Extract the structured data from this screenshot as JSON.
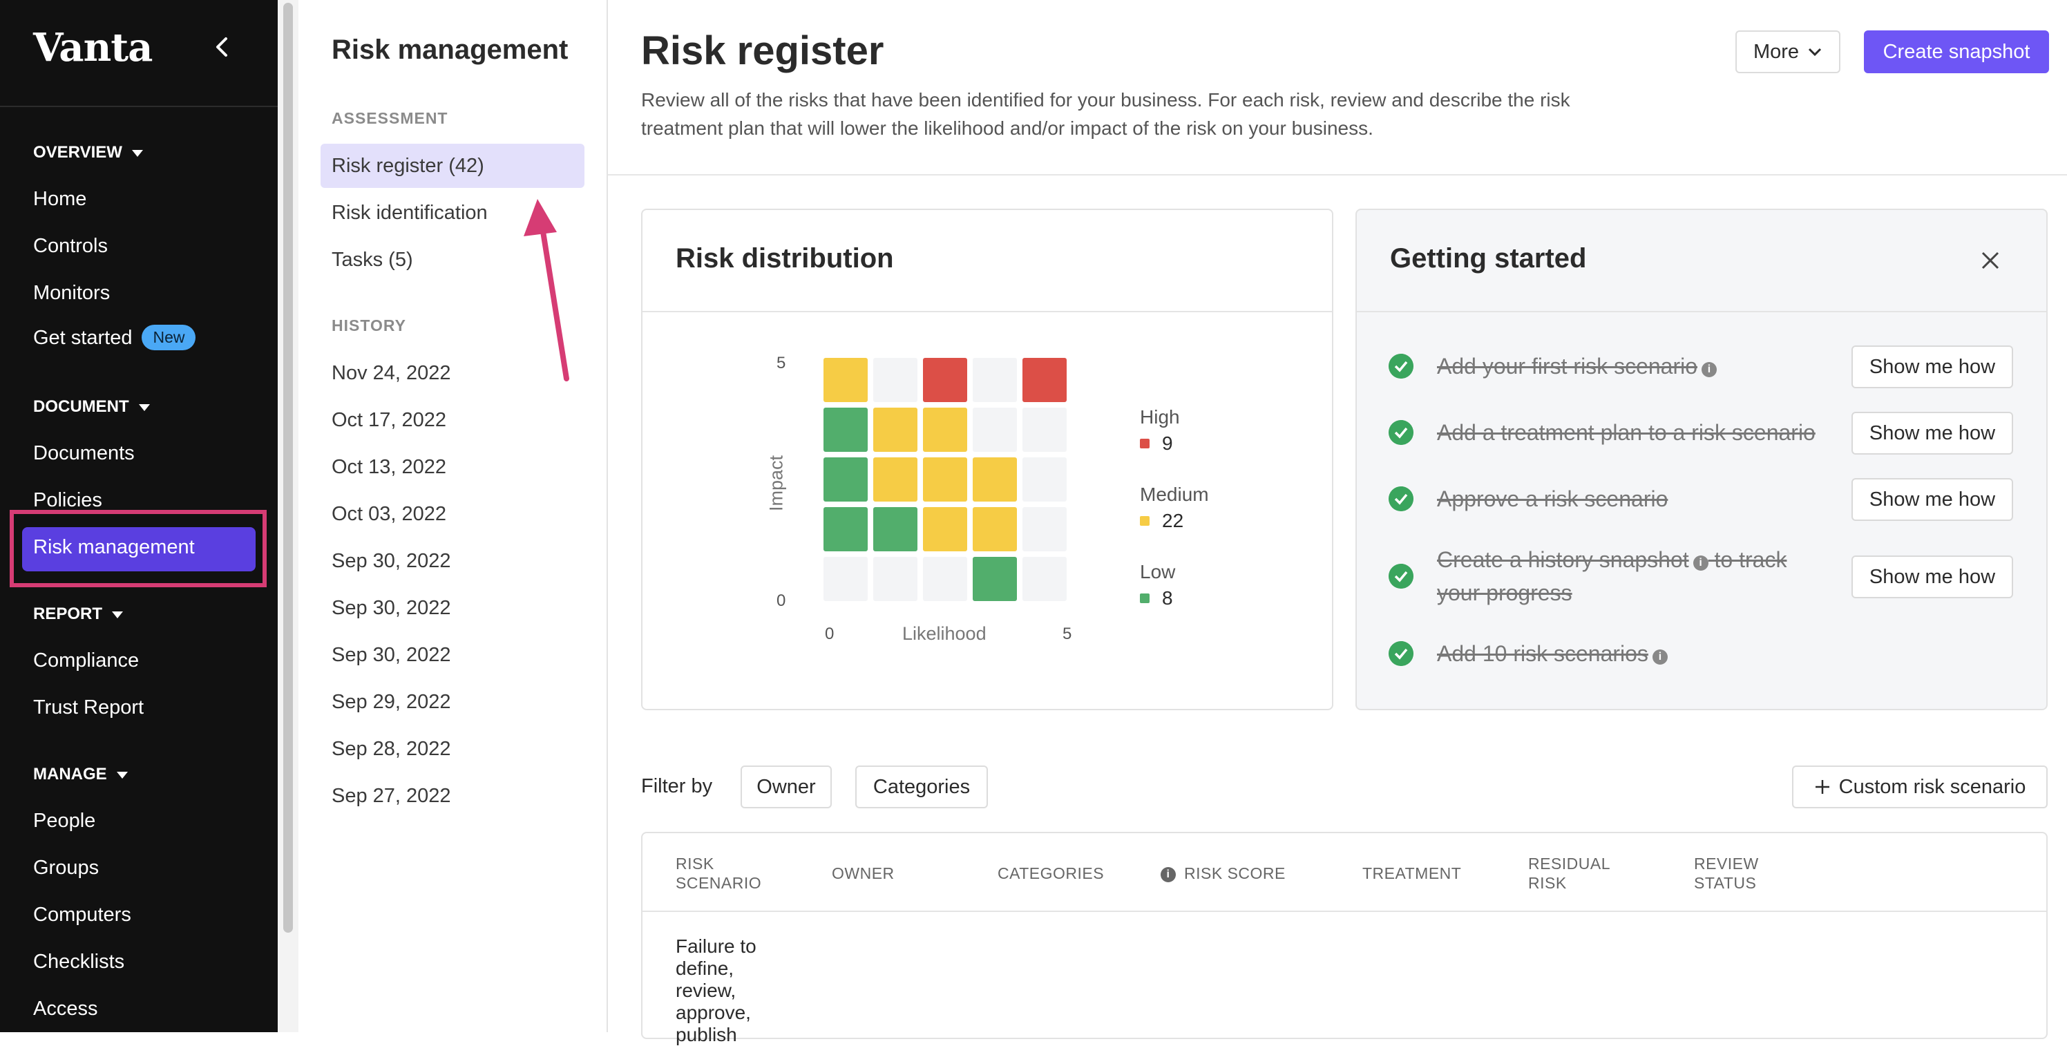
{
  "brand": {
    "logo_text": "Vanta"
  },
  "leftnav": {
    "sections": [
      {
        "label": "OVERVIEW",
        "items": [
          "Home",
          "Controls",
          "Monitors",
          "Get started"
        ]
      },
      {
        "label": "DOCUMENT",
        "items": [
          "Documents",
          "Policies",
          "Risk management"
        ]
      },
      {
        "label": "REPORT",
        "items": [
          "Compliance",
          "Trust Report"
        ]
      },
      {
        "label": "MANAGE",
        "items": [
          "People",
          "Groups",
          "Computers",
          "Checklists",
          "Access"
        ]
      }
    ],
    "new_badge": "New",
    "active_item": "Risk management"
  },
  "subnav": {
    "title": "Risk management",
    "assessment_label": "ASSESSMENT",
    "assessment_items": [
      "Risk register (42)",
      "Risk identification",
      "Tasks (5)"
    ],
    "history_label": "HISTORY",
    "history_items": [
      "Nov 24, 2022",
      "Oct 17, 2022",
      "Oct 13, 2022",
      "Oct 03, 2022",
      "Sep 30, 2022",
      "Sep 30, 2022",
      "Sep 30, 2022",
      "Sep 29, 2022",
      "Sep 28, 2022",
      "Sep 27, 2022"
    ]
  },
  "main": {
    "title": "Risk register",
    "description": "Review all of the risks that have been identified for your business. For each risk, review and describe the risk treatment plan that will lower the likelihood and/or impact of the risk on your business.",
    "more_label": "More",
    "snapshot_label": "Create snapshot"
  },
  "distribution": {
    "title": "Risk distribution",
    "y_axis_label": "Impact",
    "x_axis_label": "Likelihood",
    "y_max": "5",
    "y_min": "0",
    "x_min": "0",
    "x_max": "5",
    "legend": [
      {
        "label": "High",
        "value": "9",
        "color": "#dc4f47"
      },
      {
        "label": "Medium",
        "value": "22",
        "color": "#f6cc45"
      },
      {
        "label": "Low",
        "value": "8",
        "color": "#52ae6c"
      }
    ],
    "grid_rows_top_to_bottom": [
      [
        "medium",
        "empty",
        "high",
        "empty",
        "high"
      ],
      [
        "low",
        "medium",
        "medium",
        "empty",
        "empty"
      ],
      [
        "low",
        "medium",
        "medium",
        "medium",
        "empty"
      ],
      [
        "low",
        "low",
        "medium",
        "medium",
        "empty"
      ],
      [
        "empty",
        "empty",
        "empty",
        "low",
        "empty"
      ]
    ]
  },
  "getting_started": {
    "title": "Getting started",
    "steps": [
      {
        "text": "Add your first risk scenario",
        "button": "Show me how"
      },
      {
        "text": "Add a treatment plan to a risk scenario",
        "button": "Show me how"
      },
      {
        "text": "Approve a risk scenario",
        "button": "Show me how"
      },
      {
        "text_line1": "Create a history snapshot",
        "text_line1b": "to track",
        "text_line2": "your progress",
        "button": "Show me how"
      },
      {
        "text": "Add 10 risk scenarios"
      }
    ]
  },
  "filter": {
    "label": "Filter by",
    "owner": "Owner",
    "categories": "Categories",
    "custom": "Custom risk scenario"
  },
  "table": {
    "columns": [
      "RISK SCENARIO",
      "OWNER",
      "CATEGORIES",
      "RISK SCORE",
      "TREATMENT",
      "RESIDUAL RISK",
      "REVIEW STATUS"
    ],
    "first_row_scenario": "Failure to define, review, approve, publish"
  }
}
